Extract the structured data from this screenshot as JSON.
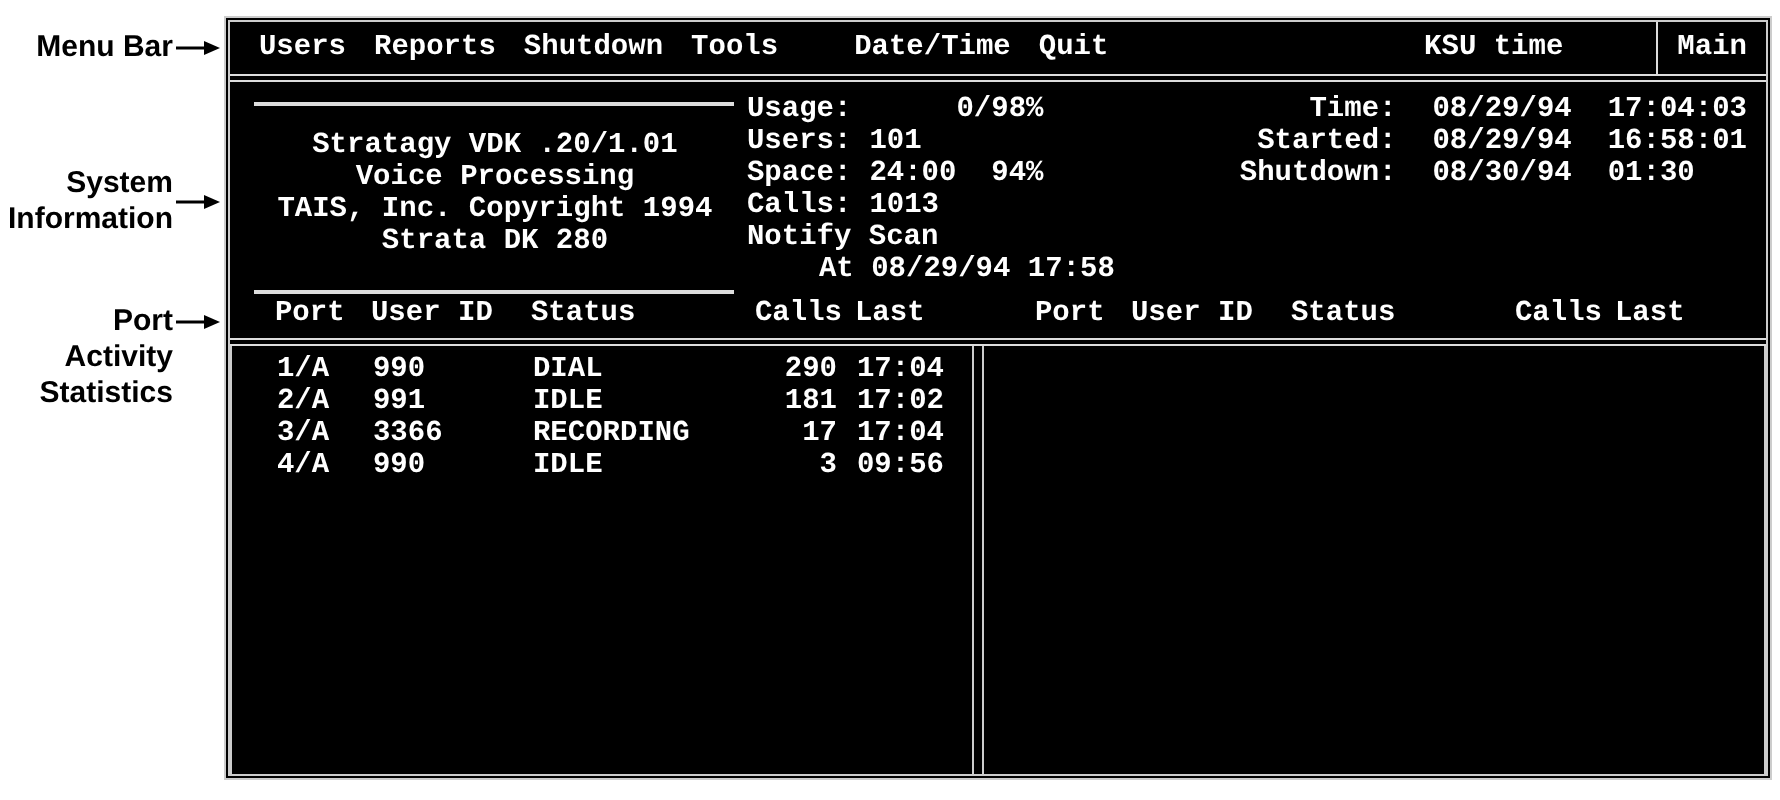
{
  "callouts": [
    {
      "label": "Menu Bar"
    },
    {
      "label": "System Information"
    },
    {
      "label": "Port Activity Statistics"
    }
  ],
  "menu": {
    "items": [
      "Users",
      "Reports",
      "Shutdown",
      "Tools",
      "Date/Time",
      "Quit"
    ],
    "clock_label": "KSU time",
    "mode": "Main"
  },
  "system_info": {
    "banner": [
      "Stratagy VDK .20/1.01",
      "Voice Processing",
      "TAIS, Inc. Copyright 1994",
      "Strata DK 280"
    ],
    "stats": [
      {
        "label": "Usage:",
        "value": "     0/98%"
      },
      {
        "label": "Users:",
        "value": "101"
      },
      {
        "label": "Space:",
        "value": "24:00  94%"
      },
      {
        "label": "Calls:",
        "value": "1013"
      }
    ],
    "notify": {
      "label": "Notify Scan",
      "at": "At 08/29/94 17:58"
    },
    "times": [
      {
        "label": "Time:",
        "date": "08/29/94",
        "time": "17:04:03"
      },
      {
        "label": "Started:",
        "date": "08/29/94",
        "time": "16:58:01"
      },
      {
        "label": "Shutdown:",
        "date": "08/30/94",
        "time": "01:30"
      }
    ]
  },
  "port_headers": [
    [
      "Port",
      "User ID",
      "Status",
      "Calls",
      "Last"
    ],
    [
      "Port",
      "User ID",
      "Status",
      "Calls",
      "Last"
    ]
  ],
  "ports": [
    {
      "port": "1/A",
      "user_id": "990",
      "status": "DIAL",
      "calls": "290",
      "last": "17:04"
    },
    {
      "port": "2/A",
      "user_id": "991",
      "status": "IDLE",
      "calls": "181",
      "last": "17:02"
    },
    {
      "port": "3/A",
      "user_id": "3366",
      "status": "RECORDING",
      "calls": "17",
      "last": "17:04"
    },
    {
      "port": "4/A",
      "user_id": "990",
      "status": "IDLE",
      "calls": "3",
      "last": "09:56"
    }
  ]
}
